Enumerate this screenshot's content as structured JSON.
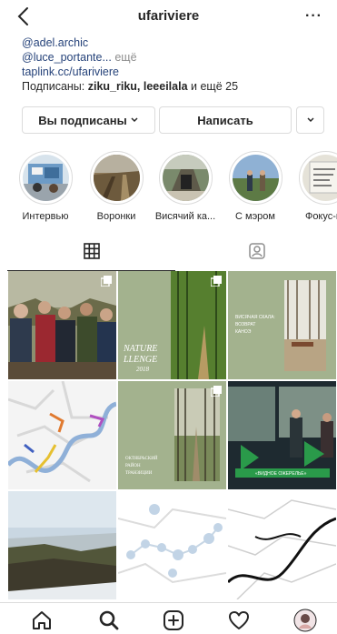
{
  "header": {
    "username": "ufariviere",
    "back_icon": "chevron-left-icon",
    "more_label": "···"
  },
  "bio": {
    "mention1": "@adel.archic",
    "mention2": "@luce_portante...",
    "more": " ещё",
    "link": "taplink.cc/ufariviere",
    "followed_prefix": "Подписаны: ",
    "followed_names": "ziku_riku, leeeilala",
    "followed_suffix": " и ещё 25"
  },
  "buttons": {
    "subscribed": "Вы подписаны",
    "message": "Написать"
  },
  "highlights": [
    {
      "label": "Интервью"
    },
    {
      "label": "Воронки"
    },
    {
      "label": "Висячий ка..."
    },
    {
      "label": "С мэром"
    },
    {
      "label": "Фокус-гр"
    }
  ],
  "tabs": {
    "grid": "grid-icon",
    "tagged": "tagged-person-icon"
  },
  "posts": [
    {
      "kind": "photo",
      "scene": "people-outdoor",
      "multi": true
    },
    {
      "kind": "text",
      "title": "NATURE\nLLENGE\n2018",
      "multi": true
    },
    {
      "kind": "text",
      "title": "ВИСЯЧАЯ СКАЛА: ВОЗВРАТ\nКАНОЭ",
      "multi": false
    },
    {
      "kind": "map",
      "scene": "river-map",
      "multi": false
    },
    {
      "kind": "text",
      "title": "ОКТЯБРЬСКИЙ\nРАЙОН\nТРАНЗИЦИИ",
      "multi": true
    },
    {
      "kind": "photo",
      "scene": "tv-studio",
      "caption": "«ВИДНОЕ ОЖЕРЕЛЬЕ»",
      "multi": false
    },
    {
      "kind": "photo",
      "scene": "forest-valley",
      "multi": false
    },
    {
      "kind": "map",
      "scene": "route-map",
      "multi": false
    },
    {
      "kind": "map",
      "scene": "line-map",
      "multi": false
    }
  ],
  "navbar": [
    "home-icon",
    "search-icon",
    "add-post-icon",
    "heart-icon",
    "profile-avatar"
  ]
}
